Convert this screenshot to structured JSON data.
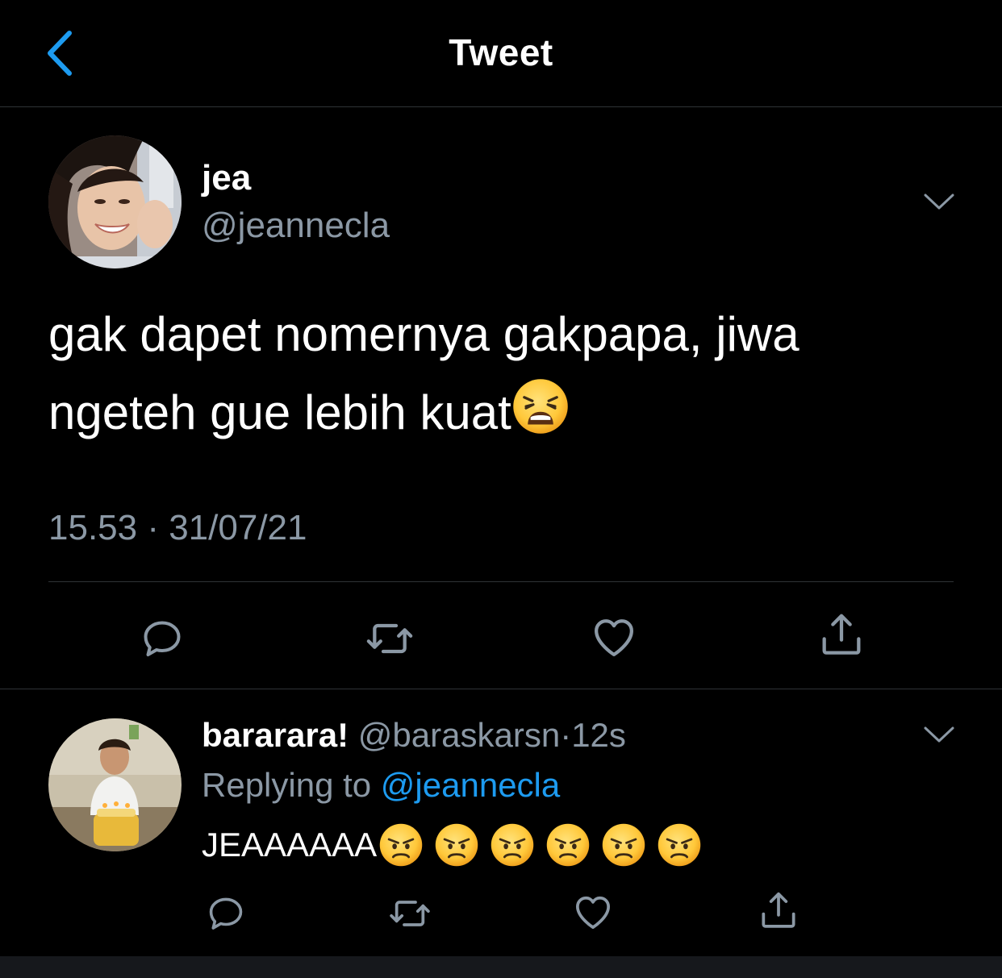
{
  "nav": {
    "title": "Tweet",
    "back_icon": "chevron-left-icon"
  },
  "tweet": {
    "display_name": "jea",
    "handle": "@jeannecla",
    "text_line1": "gak dapet nomernya gakpapa, jiwa",
    "text_line2": "ngeteh gue lebih kuat",
    "text_emoji": "weary-face-emoji",
    "timestamp": "15.53 · 31/07/21",
    "actions": [
      "reply-icon",
      "retweet-icon",
      "like-icon",
      "share-icon"
    ]
  },
  "reply": {
    "display_name": "bararara!",
    "handle": "@baraskarsn",
    "separator": "·",
    "time": "12s",
    "replying_prefix": "Replying to",
    "replying_handle": "@jeannecla",
    "text": "JEAAAAAA",
    "emojis": [
      "angry-face-emoji",
      "angry-face-emoji",
      "angry-face-emoji",
      "angry-face-emoji",
      "angry-face-emoji",
      "angry-face-emoji"
    ],
    "actions": [
      "reply-icon",
      "retweet-icon",
      "like-icon",
      "share-icon"
    ]
  },
  "colors": {
    "background": "#000000",
    "primary_text": "#ffffff",
    "secondary_text": "#8b98a5",
    "accent": "#1d9bf0",
    "divider": "#2f3336"
  }
}
